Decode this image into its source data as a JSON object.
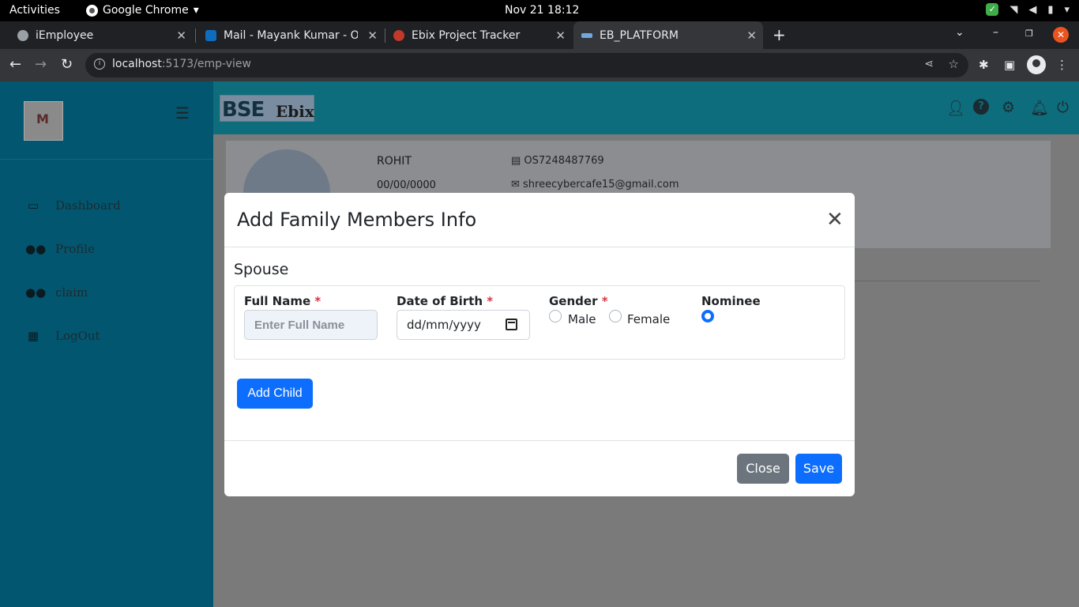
{
  "os_bar": {
    "activities": "Activities",
    "app_name": "Google Chrome",
    "clock": "Nov 21  18:12"
  },
  "browser": {
    "tabs": [
      {
        "title": "iEmployee",
        "favicon_color": "#9aa0a6"
      },
      {
        "title": "Mail - Mayank Kumar - Ou",
        "favicon_color": "#0f6cbd"
      },
      {
        "title": "Ebix Project Tracker",
        "favicon_color": "#c0392b"
      },
      {
        "title": "EB_PLATFORM",
        "favicon_color": "#6fa8dc"
      }
    ],
    "active_tab": 3,
    "url_host": "localhost",
    "url_path": ":5173/emp-view"
  },
  "sidebar": {
    "logo_text": "M",
    "items": [
      {
        "label": "Dashboard",
        "icon": "dashboard-icon"
      },
      {
        "label": "Profile",
        "icon": "users-icon"
      },
      {
        "label": "claim",
        "icon": "users-icon"
      },
      {
        "label": "LogOut",
        "icon": "grid-icon"
      }
    ]
  },
  "header": {
    "brand_left": "BSE",
    "brand_right": "Ebix",
    "icons": [
      "user-icon",
      "help-icon",
      "settings-icon",
      "bell-icon",
      "power-icon"
    ]
  },
  "profile": {
    "name": "ROHIT",
    "dob": "00/00/0000",
    "id": "OS7248487769",
    "email": "shreecybercafe15@gmail.com"
  },
  "modal": {
    "title": "Add Family Members Info",
    "section": "Spouse",
    "fields": {
      "full_name_label": "Full Name",
      "full_name_placeholder": "Enter Full Name",
      "dob_label": "Date of Birth",
      "dob_value": "dd/mm/yyyy",
      "gender_label": "Gender",
      "gender_options": [
        "Male",
        "Female"
      ],
      "nominee_label": "Nominee",
      "required_mark": "*"
    },
    "add_child": "Add Child",
    "close": "Close",
    "save": "Save"
  },
  "colors": {
    "sidebar": "#03566f",
    "header": "#0e6d7c",
    "primary": "#0d6efd",
    "secondary": "#6c757d",
    "required": "#dc3545"
  }
}
